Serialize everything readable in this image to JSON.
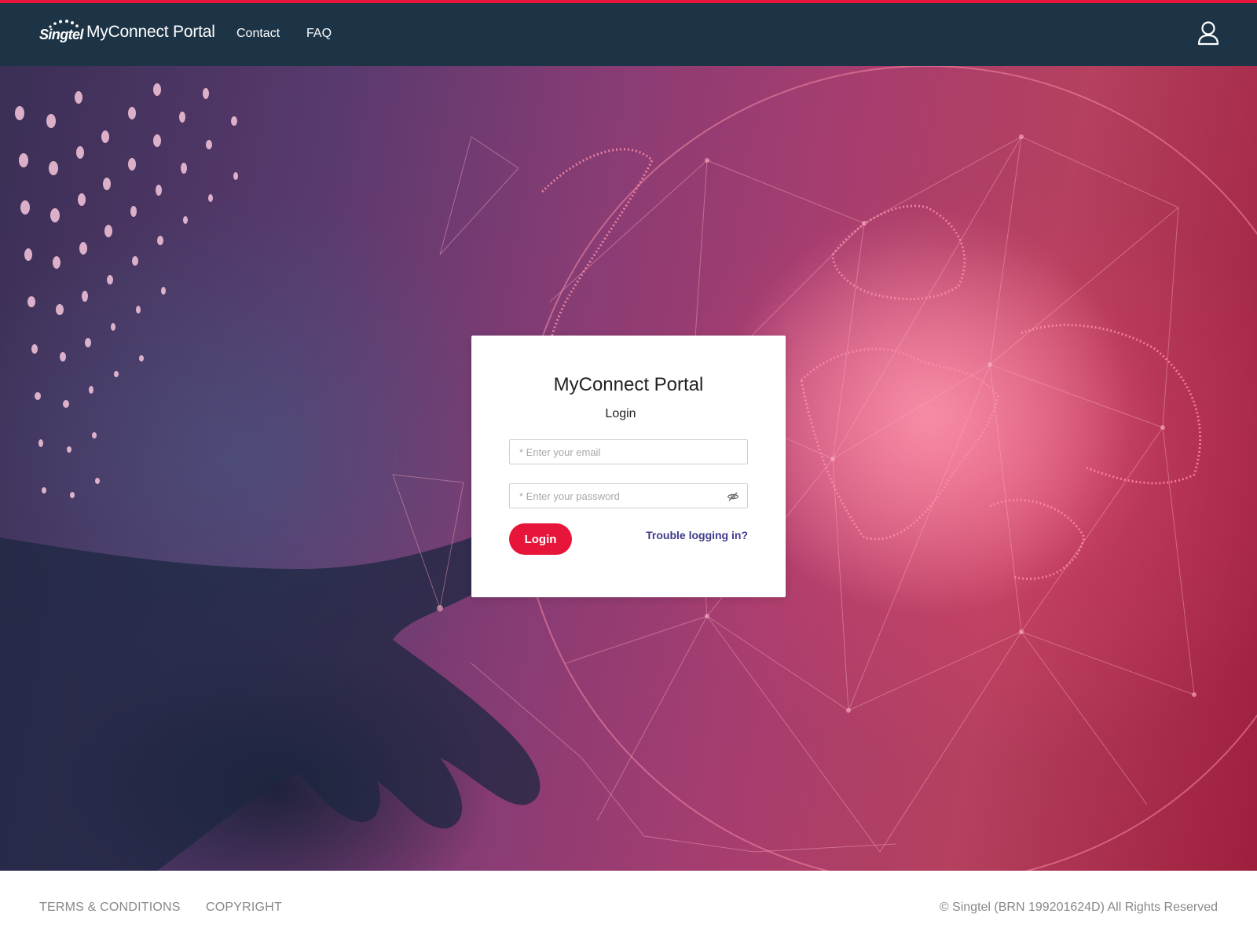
{
  "header": {
    "logo_text": "Singtel",
    "brand_title": "MyConnect Portal",
    "nav": [
      {
        "label": "Contact"
      },
      {
        "label": "FAQ"
      }
    ],
    "user_icon": "user-icon"
  },
  "login": {
    "title": "MyConnect Portal",
    "subtitle": "Login",
    "email_placeholder": "* Enter your email",
    "email_value": "",
    "password_placeholder": "* Enter your password",
    "password_value": "",
    "password_toggle_icon": "eye-slash-icon",
    "login_label": "Login",
    "trouble_label": "Trouble logging in?"
  },
  "footer": {
    "terms_label": "TERMS & CONDITIONS",
    "copyright_label": "COPYRIGHT",
    "rights_text": "© Singtel (BRN 199201624D) All Rights Reserved"
  },
  "colors": {
    "accent": "#e8153b",
    "header_bg": "#1d3446",
    "link": "#3f3a8c"
  }
}
